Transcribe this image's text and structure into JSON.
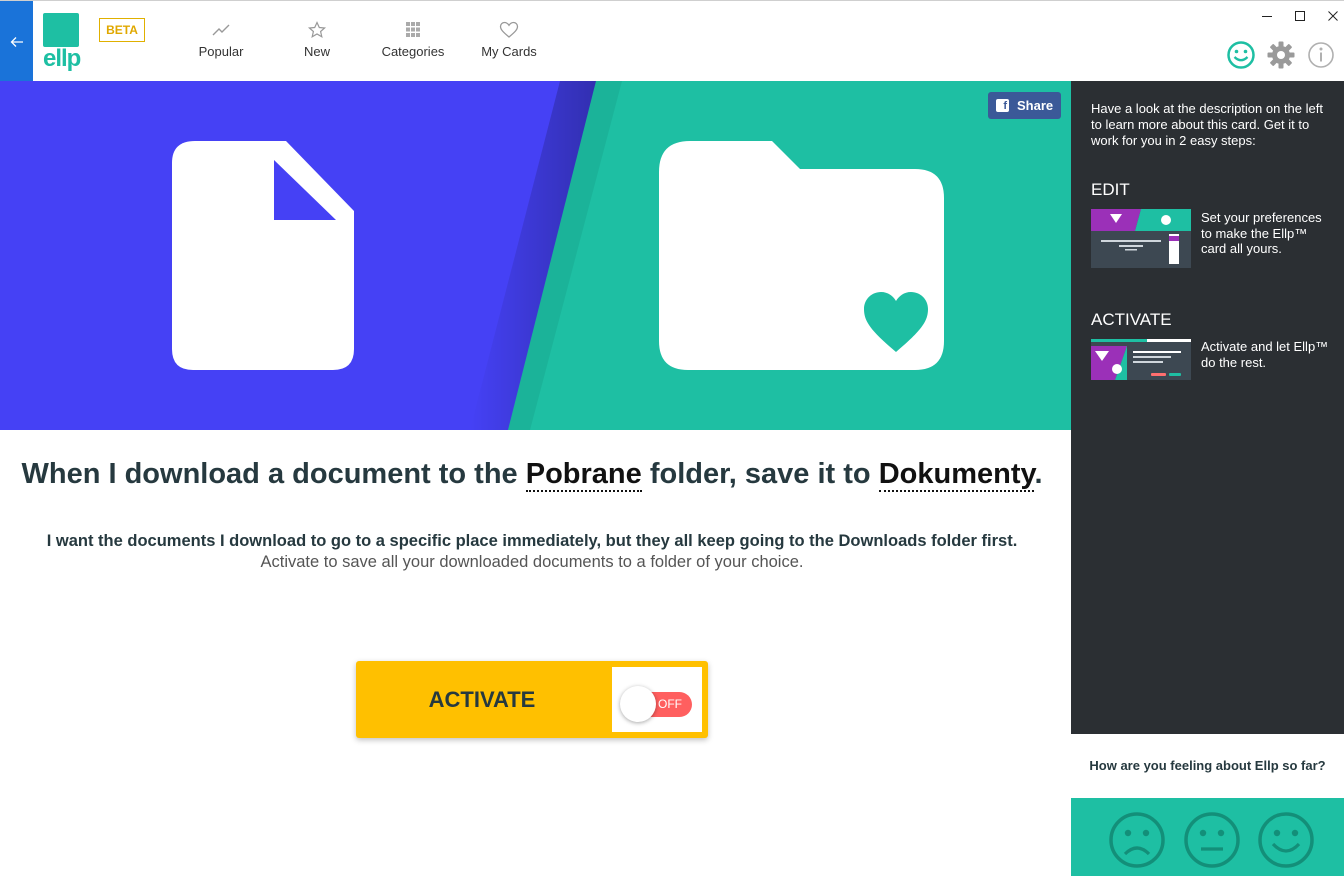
{
  "app": {
    "logo_text": "ellp",
    "beta": "BETA"
  },
  "nav": {
    "items": [
      {
        "label": "Popular",
        "icon": "trending-icon"
      },
      {
        "label": "New",
        "icon": "star-icon"
      },
      {
        "label": "Categories",
        "icon": "grid-icon"
      },
      {
        "label": "My Cards",
        "icon": "heart-icon"
      }
    ]
  },
  "hero": {
    "share_label": "Share",
    "share_icon_letter": "f"
  },
  "card": {
    "headline_part1": "When I download a document to the ",
    "var_source": "Pobrane",
    "headline_part2": " folder, save it to ",
    "var_target": "Dokumenty",
    "headline_part3": ".",
    "desc_bold": "I want the documents I download to go to a specific place immediately, but they all keep going to the Downloads folder first.",
    "desc": "Activate to save all your downloaded documents to a folder of your choice."
  },
  "activate": {
    "label": "ACTIVATE",
    "toggle_state": "OFF"
  },
  "sidebar": {
    "intro": "Have a look at the description on the left to learn more about this card. Get it to work for you in 2 easy steps:",
    "steps": [
      {
        "title": "EDIT",
        "text": "Set your preferences to make the Ellp™ card all yours."
      },
      {
        "title": "ACTIVATE",
        "text": "Activate and let Ellp™ do the rest."
      }
    ]
  },
  "feedback": {
    "question": "How are you feeling about Ellp so far?"
  },
  "colors": {
    "brand": "#1ebfa3",
    "hero_left": "#4541f5",
    "accent": "#ffc000",
    "toggle_off": "#ff5f5f",
    "sidebar_bg": "#2b2f33",
    "back_btn": "#1a73d9"
  }
}
